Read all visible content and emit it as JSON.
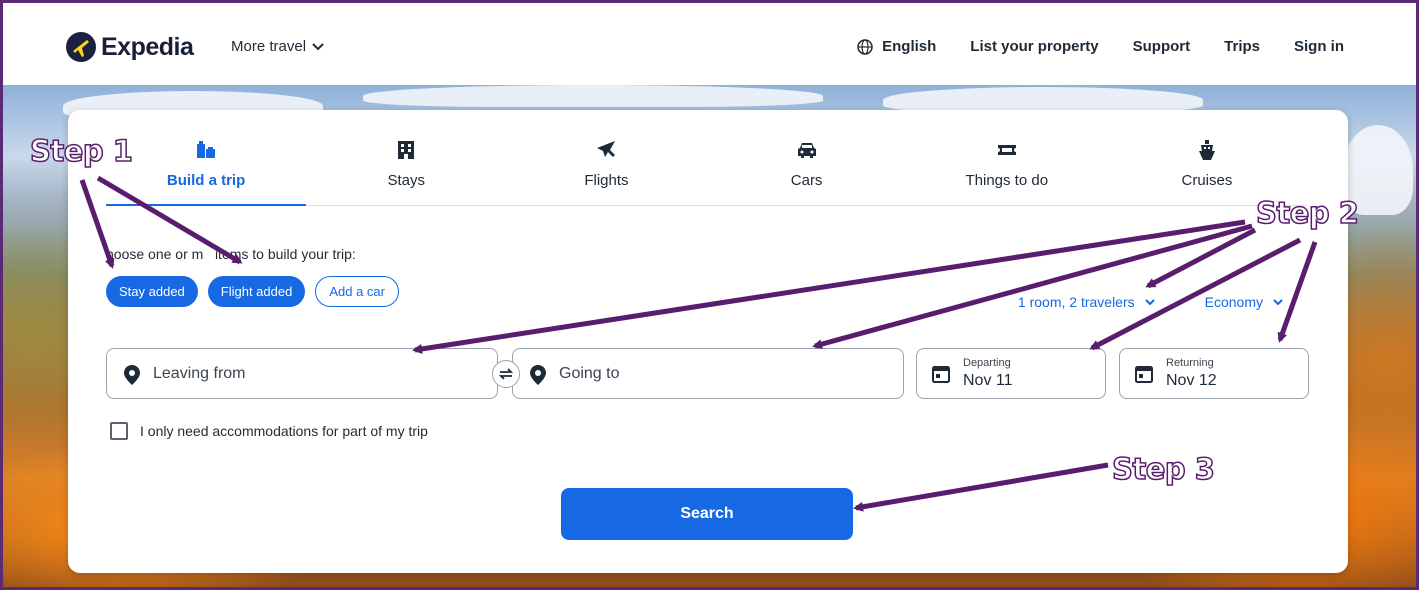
{
  "header": {
    "logo_text": "Expedia",
    "more_travel": "More travel",
    "nav": {
      "language": "English",
      "list_property": "List your property",
      "support": "Support",
      "trips": "Trips",
      "sign_in": "Sign in"
    }
  },
  "tabs": [
    {
      "label": "Build a trip",
      "icon": "build-trip-icon",
      "active": true
    },
    {
      "label": "Stays",
      "icon": "building-icon",
      "active": false
    },
    {
      "label": "Flights",
      "icon": "plane-icon",
      "active": false
    },
    {
      "label": "Cars",
      "icon": "car-icon",
      "active": false
    },
    {
      "label": "Things to do",
      "icon": "ticket-icon",
      "active": false
    },
    {
      "label": "Cruises",
      "icon": "cruise-icon",
      "active": false
    }
  ],
  "form": {
    "instructions": "hoose one or m   items to build your trip:",
    "chips": [
      {
        "label": "Stay added",
        "selected": true
      },
      {
        "label": "Flight added",
        "selected": true
      },
      {
        "label": "Add a car",
        "selected": false
      }
    ],
    "travelers": "1 room, 2 travelers",
    "cabin_class": "Economy",
    "leaving_from_placeholder": "Leaving from",
    "going_to_placeholder": "Going to",
    "departing_label": "Departing",
    "departing_value": "Nov 11",
    "returning_label": "Returning",
    "returning_value": "Nov 12",
    "accommodation_checkbox_label": "I only need accommodations for part of my trip",
    "search_button": "Search"
  },
  "annotations": {
    "step1": "Step 1",
    "step2": "Step 2",
    "step3": "Step 3",
    "arrow_color": "#5a1d6e"
  },
  "colors": {
    "accent": "#1668e3",
    "frame": "#5a2a74"
  }
}
